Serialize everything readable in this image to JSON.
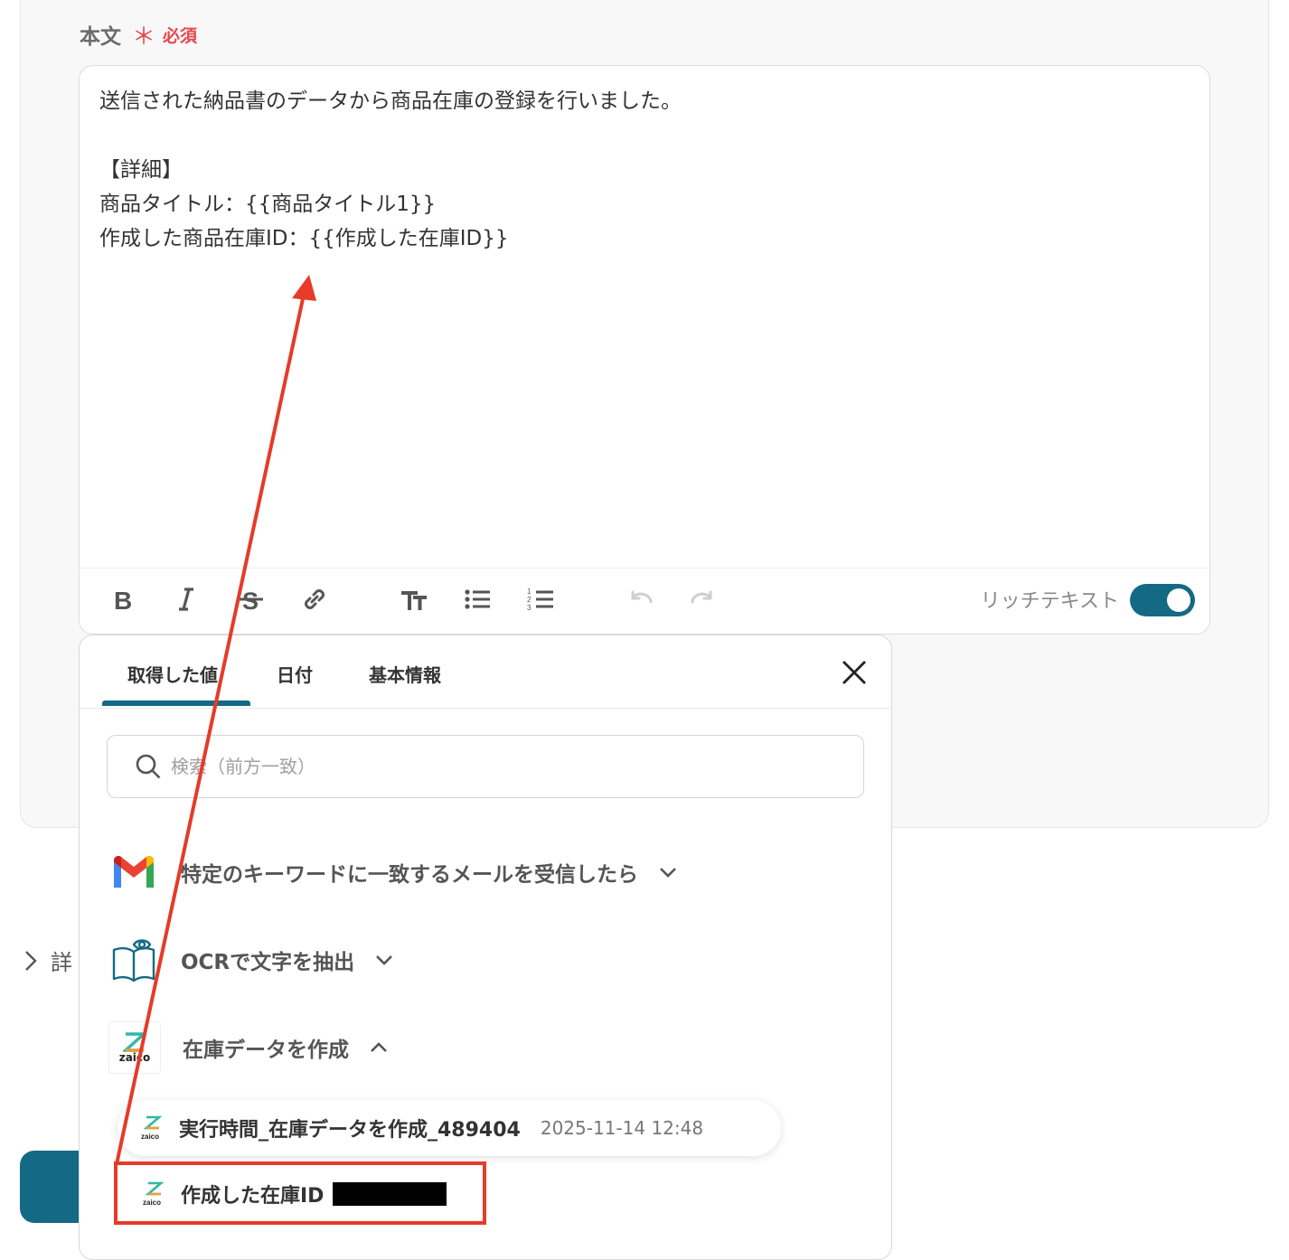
{
  "field": {
    "label": "本文",
    "required_mark": "＊",
    "required_text": "必須"
  },
  "editor": {
    "lines": [
      "送信された納品書のデータから商品在庫の登録を行いました。",
      "",
      "【詳細】",
      "商品タイトル：{{商品タイトル1}}",
      "作成した商品在庫ID：{{作成した在庫ID}}"
    ],
    "rich_text_label": "リッチテキスト",
    "rich_text_enabled": true,
    "toolbar_icons": [
      "bold-icon",
      "italic-icon",
      "strikethrough-icon",
      "link-icon",
      "text-size-icon",
      "bullet-list-icon",
      "numbered-list-icon",
      "undo-icon",
      "redo-icon"
    ]
  },
  "popup": {
    "tabs": [
      "取得した値",
      "日付",
      "基本情報"
    ],
    "active_tab": 0,
    "search_placeholder": "検索（前方一致）",
    "sources": [
      {
        "icon": "gmail-icon",
        "label": "特定のキーワードに一致するメールを受信したら",
        "expanded": false
      },
      {
        "icon": "ocr-book-icon",
        "label": "OCRで文字を抽出",
        "expanded": false
      },
      {
        "icon": "zaico-icon",
        "label": "在庫データを作成",
        "expanded": true
      }
    ],
    "values": [
      {
        "name": "実行時間_在庫データを作成_489404",
        "value": "2025-11-14 12:48"
      },
      {
        "name": "作成した在庫ID",
        "value": ""
      }
    ],
    "zaico_logo_text": "zaico"
  },
  "side": {
    "label": "詳"
  },
  "colors": {
    "accent": "#146a84",
    "required": "#e5484d",
    "annotation": "#e53b28"
  }
}
